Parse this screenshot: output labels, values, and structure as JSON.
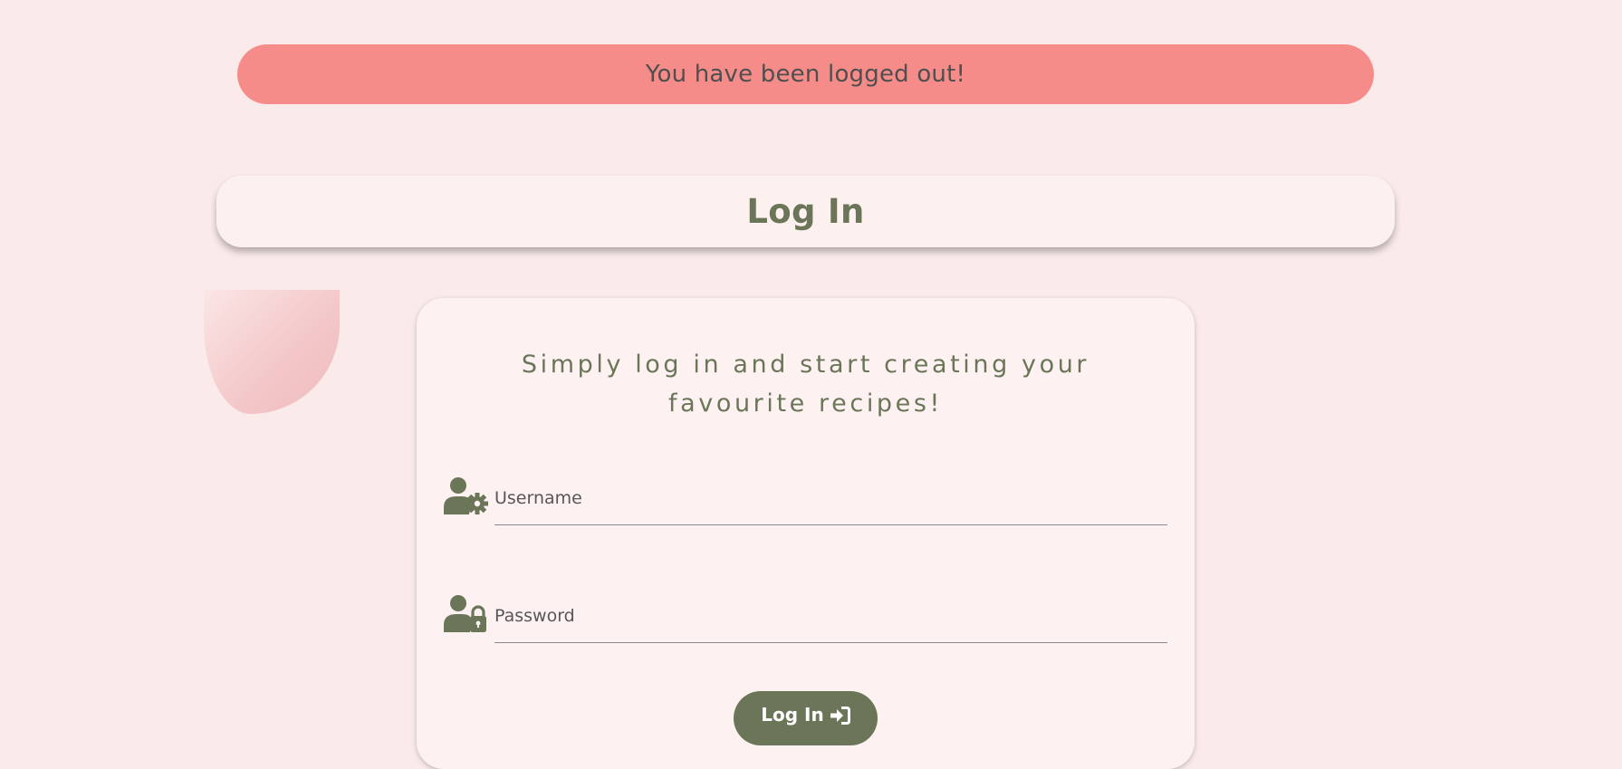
{
  "flash": {
    "message": "You have been logged out!"
  },
  "header": {
    "title": "Log In"
  },
  "form": {
    "intro": "Simply log in and start creating your favourite recipes!",
    "username": {
      "placeholder": "Username",
      "value": "",
      "icon": "user-gear-icon"
    },
    "password": {
      "placeholder": "Password",
      "value": "",
      "icon": "user-lock-icon"
    },
    "submit": {
      "label": "Log In",
      "icon": "sign-in-icon"
    }
  },
  "colors": {
    "background": "#fbeaea",
    "flash": "#f58c89",
    "card": "#fdf2f1",
    "accent": "#6b7558"
  }
}
